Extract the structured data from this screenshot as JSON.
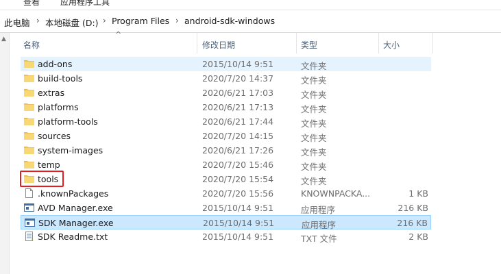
{
  "ribbon": {
    "tab_view": "查看",
    "tab_app_tools": "应用程序工具"
  },
  "address": {
    "crumbs": [
      "此电脑",
      "本地磁盘 (D:)",
      "Program Files",
      "android-sdk-windows"
    ]
  },
  "columns": {
    "name": "名称",
    "date": "修改日期",
    "type": "类型",
    "size": "大小"
  },
  "files": [
    {
      "name": "add-ons",
      "date": "2015/10/14 9:51",
      "type": "文件夹",
      "size": "",
      "icon": "folder-icon"
    },
    {
      "name": "build-tools",
      "date": "2020/7/20 14:37",
      "type": "文件夹",
      "size": "",
      "icon": "folder-icon"
    },
    {
      "name": "extras",
      "date": "2020/6/21 17:03",
      "type": "文件夹",
      "size": "",
      "icon": "folder-icon"
    },
    {
      "name": "platforms",
      "date": "2020/6/21 17:13",
      "type": "文件夹",
      "size": "",
      "icon": "folder-icon"
    },
    {
      "name": "platform-tools",
      "date": "2020/6/21 17:44",
      "type": "文件夹",
      "size": "",
      "icon": "folder-icon"
    },
    {
      "name": "sources",
      "date": "2020/7/20 14:15",
      "type": "文件夹",
      "size": "",
      "icon": "folder-icon"
    },
    {
      "name": "system-images",
      "date": "2020/6/21 17:26",
      "type": "文件夹",
      "size": "",
      "icon": "folder-icon"
    },
    {
      "name": "temp",
      "date": "2020/7/20 15:46",
      "type": "文件夹",
      "size": "",
      "icon": "folder-icon"
    },
    {
      "name": "tools",
      "date": "2020/7/20 15:54",
      "type": "文件夹",
      "size": "",
      "icon": "folder-icon"
    },
    {
      "name": ".knownPackages",
      "date": "2020/7/20 15:56",
      "type": "KNOWNPACKA...",
      "size": "1 KB",
      "icon": "file-icon"
    },
    {
      "name": "AVD Manager.exe",
      "date": "2015/10/14 9:51",
      "type": "应用程序",
      "size": "216 KB",
      "icon": "exe-icon"
    },
    {
      "name": "SDK Manager.exe",
      "date": "2015/10/14 9:51",
      "type": "应用程序",
      "size": "216 KB",
      "icon": "exe-icon"
    },
    {
      "name": "SDK Readme.txt",
      "date": "2015/10/14 9:51",
      "type": "TXT 文件",
      "size": "2 KB",
      "icon": "txt-icon"
    }
  ],
  "colors": {
    "hover_row": "#e5f3ff",
    "selected_row": "#cce8ff",
    "highlight_box": "#e02020",
    "folder": "#f8d775"
  }
}
